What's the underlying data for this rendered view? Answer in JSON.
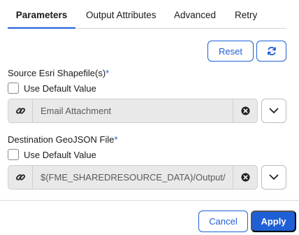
{
  "tabs": [
    {
      "label": "Parameters",
      "active": true
    },
    {
      "label": "Output Attributes"
    },
    {
      "label": "Advanced"
    },
    {
      "label": "Retry"
    }
  ],
  "toolbar": {
    "reset_label": "Reset",
    "refresh_icon": "refresh-icon"
  },
  "source": {
    "label": "Source Esri Shapefile(s)",
    "required_mark": "*",
    "use_default_label": "Use Default Value",
    "use_default_checked": false,
    "value": "Email Attachment",
    "link_icon": "link-icon",
    "clear_icon": "clear-icon",
    "dropdown_icon": "chevron-down-icon"
  },
  "destination": {
    "label": "Destination GeoJSON File",
    "required_mark": "*",
    "use_default_label": "Use Default Value",
    "use_default_checked": false,
    "value": "$(FME_SHAREDRESOURCE_DATA)/Output/",
    "link_icon": "link-icon",
    "clear_icon": "clear-icon",
    "dropdown_icon": "chevron-down-icon"
  },
  "footer": {
    "cancel_label": "Cancel",
    "apply_label": "Apply"
  },
  "colors": {
    "accent": "#1f5fd6",
    "input_bg": "#e9e9e9"
  }
}
